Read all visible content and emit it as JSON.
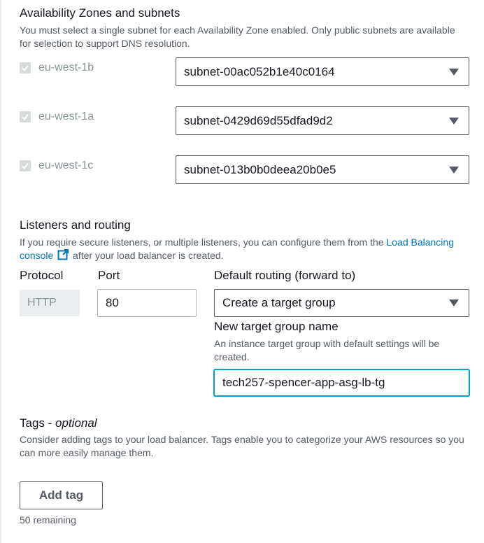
{
  "az": {
    "heading": "Availability Zones and subnets",
    "description": "You must select a single subnet for each Availability Zone enabled. Only public subnets are available for selection to support DNS resolution.",
    "rows": [
      {
        "zone": "eu-west-1b",
        "subnet": "subnet-00ac052b1e40c0164"
      },
      {
        "zone": "eu-west-1a",
        "subnet": "subnet-0429d69d55dfad9d2"
      },
      {
        "zone": "eu-west-1c",
        "subnet": "subnet-013b0b0deea20b0e5"
      }
    ]
  },
  "listeners": {
    "heading": "Listeners and routing",
    "description_before": "If you require secure listeners, or multiple listeners, you can configure them from the ",
    "link_text": "Load Balancing console",
    "description_after": " after your load balancer is created.",
    "protocol_label": "Protocol",
    "port_label": "Port",
    "routing_label": "Default routing (forward to)",
    "protocol_value": "HTTP",
    "port_value": "80",
    "routing_value": "Create a target group",
    "tg_name_label": "New target group name",
    "tg_name_description": "An instance target group with default settings will be created.",
    "tg_name_value": "tech257-spencer-app-asg-lb-tg"
  },
  "tags": {
    "heading": "Tags - ",
    "heading_optional": "optional",
    "description": "Consider adding tags to your load balancer. Tags enable you to categorize your AWS resources so you can more easily manage them.",
    "add_tag_label": "Add tag",
    "remaining": "50 remaining"
  }
}
